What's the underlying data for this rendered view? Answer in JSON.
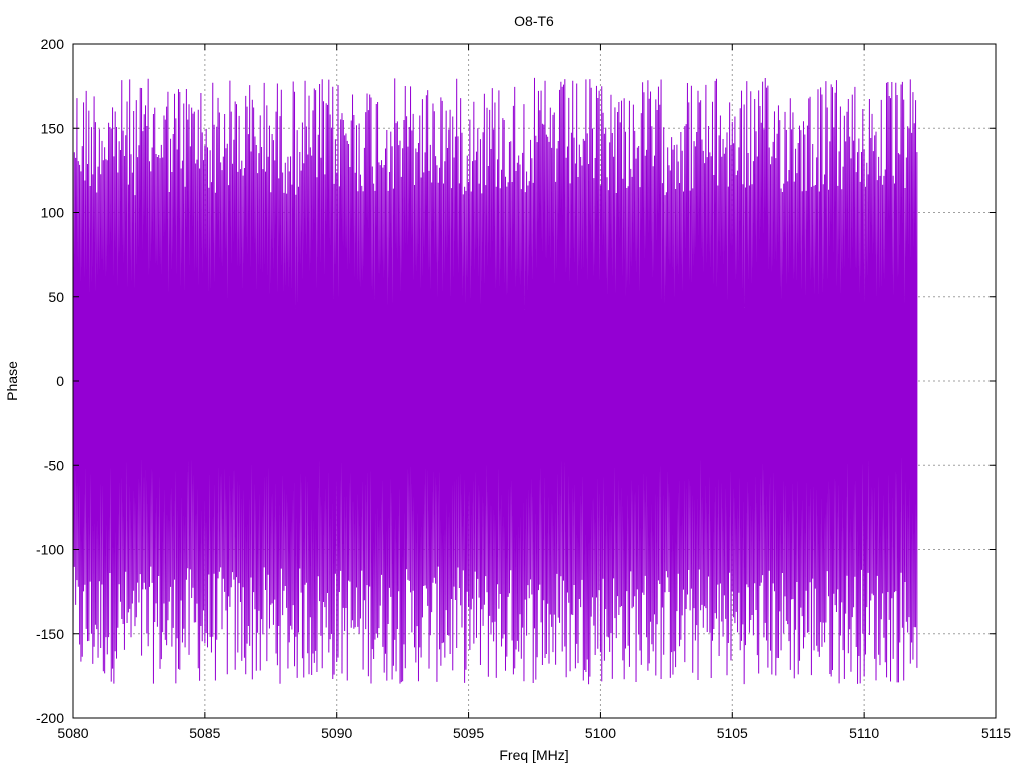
{
  "chart_data": {
    "type": "line",
    "title": "O8-T6",
    "xlabel": "Freq [MHz]",
    "ylabel": "Phase",
    "xlim": [
      5080,
      5115
    ],
    "ylim": [
      -200,
      200
    ],
    "x_ticks": [
      5080,
      5085,
      5090,
      5095,
      5100,
      5105,
      5110,
      5115
    ],
    "x_tick_labels": [
      "5080",
      "5085",
      "5090",
      "5095",
      "5100",
      "5105",
      "5110",
      "5115"
    ],
    "y_ticks": [
      -200,
      -150,
      -100,
      -50,
      0,
      50,
      100,
      150,
      200
    ],
    "y_tick_labels": [
      "-200",
      "-150",
      "-100",
      "-50",
      "0",
      "50",
      "100",
      "150",
      "200"
    ],
    "grid": true,
    "grid_style": "dotted",
    "series": [
      {
        "color": "#9400d3",
        "x_range": [
          5080,
          5112
        ],
        "y_range": [
          -180,
          180
        ],
        "description_pattern": "phase wraps rapidly between about -180 and 180",
        "sample_count": 640
      }
    ]
  }
}
